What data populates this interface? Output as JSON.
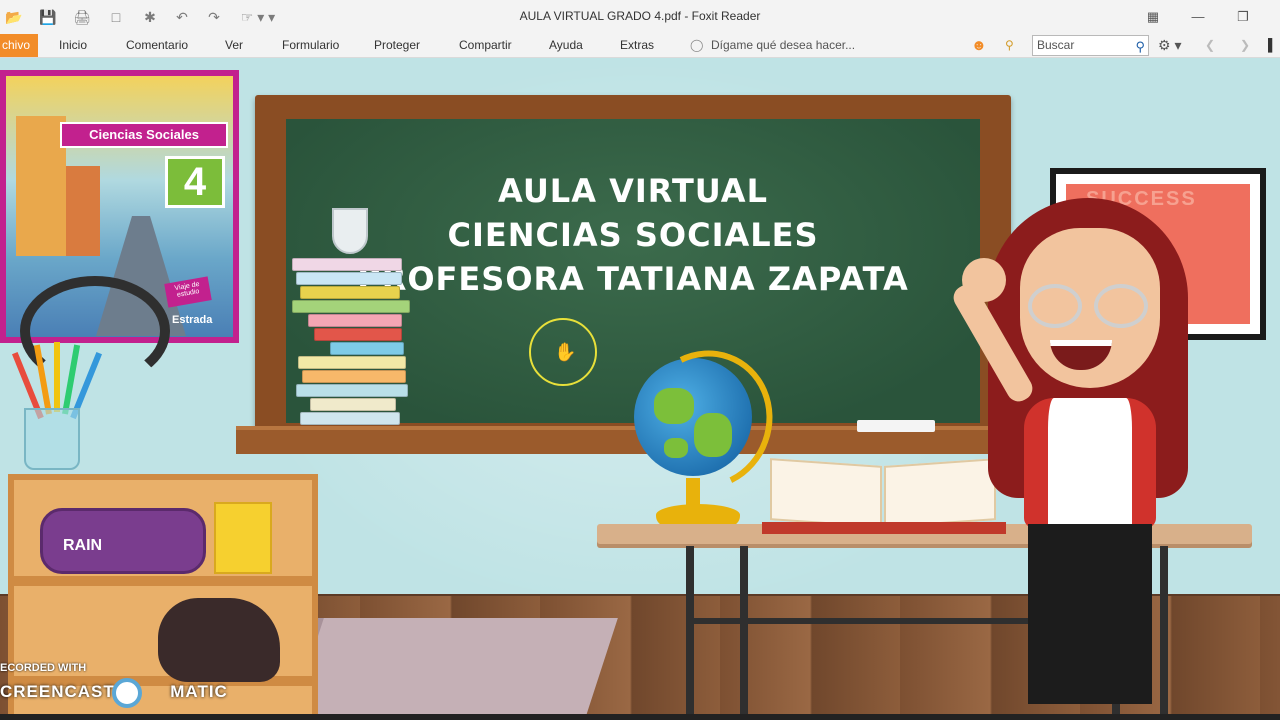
{
  "window": {
    "title": "AULA VIRTUAL  GRADO 4.pdf - Foxit Reader",
    "quick_access_icons": [
      "open-icon",
      "save-icon",
      "print-icon",
      "email-icon",
      "new-icon",
      "undo-icon",
      "redo-icon",
      "hand-tool-icon"
    ],
    "controls": [
      "restore-icon",
      "minimize-icon",
      "maximize-icon"
    ]
  },
  "menu": {
    "file_tab": "chivo",
    "items": [
      "Inicio",
      "Comentario",
      "Ver",
      "Formulario",
      "Proteger",
      "Compartir",
      "Ayuda",
      "Extras"
    ],
    "tell_me": "Dígame qué desea hacer...",
    "search_placeholder": "Buscar"
  },
  "document": {
    "board_lines": [
      "AULA  VIRTUAL",
      "CIENCIAS SOCIALES",
      "PROFESORA TATIANA ZAPATA"
    ],
    "book_cover": {
      "title": "Ciencias Sociales",
      "grade": "4",
      "tag": "Viaje de estudio",
      "publisher": "Estrada"
    },
    "poster_text": "SUCCESS",
    "pencil_case_text": "RAIN",
    "accent_colors": {
      "orange": "#f28c28",
      "board": "#2f5a3f",
      "cover": "#c2218e"
    }
  },
  "watermark": {
    "line1": "ECORDED WITH",
    "line2": "CREENCAST",
    "line3": "MATIC"
  }
}
